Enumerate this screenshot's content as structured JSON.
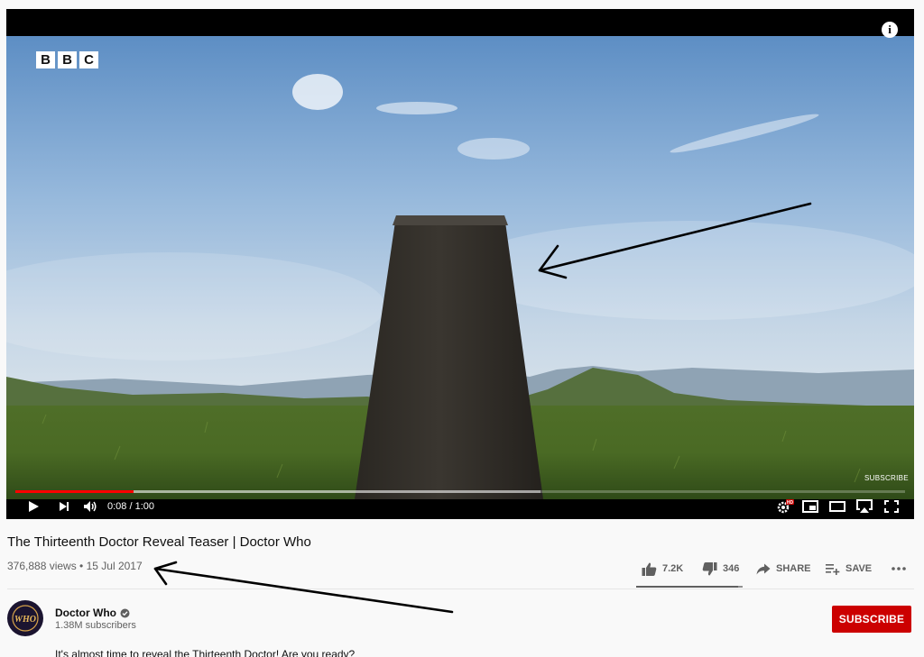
{
  "video": {
    "brand_logo": "BBC",
    "brand_letters": [
      "B",
      "B",
      "C"
    ],
    "info_symbol": "i",
    "watermark": "SUBSCRIBE",
    "progress": 0.133,
    "buffered": 0.59,
    "time_display": "0:08 / 1:00",
    "hd_badge": "HD",
    "icons": [
      "play-icon",
      "next-icon",
      "volume-icon",
      "settings-icon",
      "miniplayer-icon",
      "theater-icon",
      "airplay-icon",
      "fullscreen-icon"
    ]
  },
  "details": {
    "title": "The Thirteenth Doctor Reveal Teaser | Doctor Who",
    "meta": "376,888 views • 15 Jul 2017",
    "likes": "7.2K",
    "dislikes": "346",
    "share_label": "SHARE",
    "save_label": "SAVE",
    "more_icon": "more-icon"
  },
  "channel": {
    "name": "Doctor Who",
    "verified": true,
    "subscribers": "1.38M subscribers",
    "subscribe_label": "SUBSCRIBE",
    "avatar_text": "WHO"
  },
  "description": {
    "text": "It's almost time to reveal the Thirteenth Doctor! Are you ready?"
  },
  "colors": {
    "accent_red": "#ff0000",
    "subscribe_red": "#cc0000",
    "text_primary": "#0f0f0f",
    "text_secondary": "#606060"
  }
}
